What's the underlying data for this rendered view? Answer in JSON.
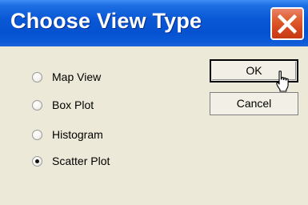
{
  "window": {
    "title": "Choose View Type"
  },
  "options": [
    {
      "label": "Map View",
      "selected": false
    },
    {
      "label": "Box Plot",
      "selected": false
    },
    {
      "label": "Histogram",
      "selected": false
    },
    {
      "label": "Scatter Plot",
      "selected": true
    }
  ],
  "buttons": {
    "ok_label": "OK",
    "cancel_label": "Cancel"
  },
  "icons": {
    "close": "close-icon",
    "cursor": "hand-pointer-cursor"
  },
  "colors": {
    "titlebar": "#0552d0",
    "close_button": "#d4451c",
    "dialog_background": "#ece9d8"
  }
}
